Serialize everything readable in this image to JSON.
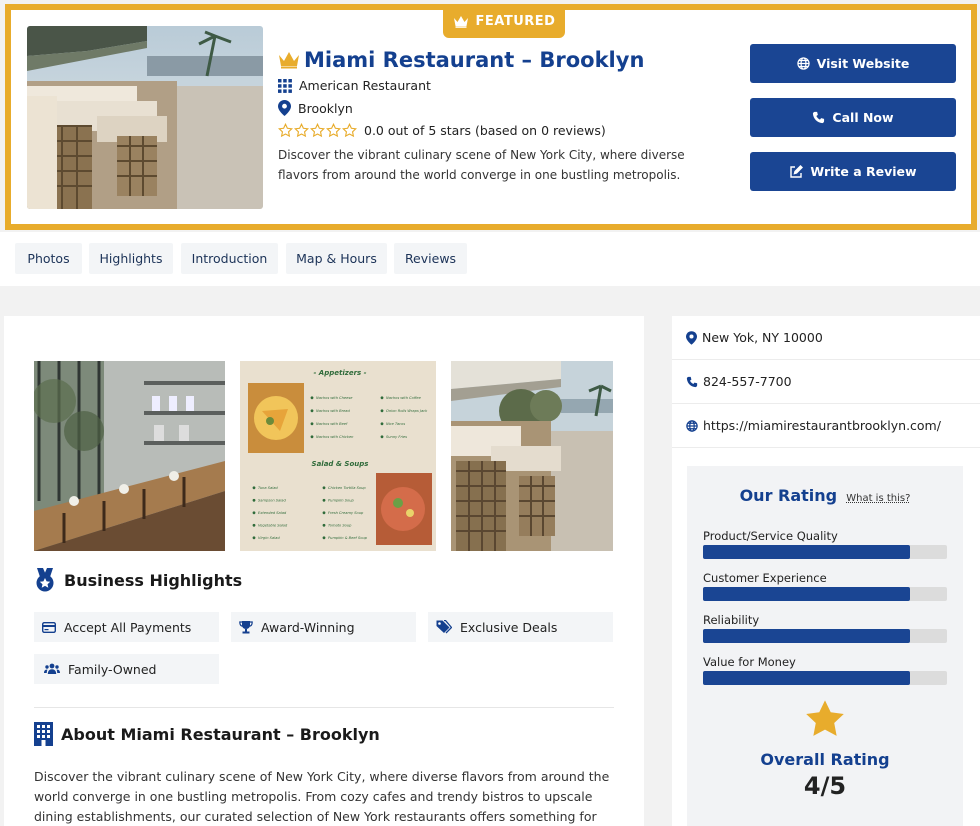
{
  "featured_badge": "FEATURED",
  "listing": {
    "title": "Miami Restaurant – Brooklyn",
    "category": "American Restaurant",
    "location": "Brooklyn",
    "stars_total": 5,
    "rating_text": "0.0 out of 5 stars (based on 0 reviews)",
    "description": "Discover the vibrant culinary scene of New York City, where diverse flavors from around the world converge in one bustling metropolis."
  },
  "actions": {
    "visit_website": "Visit Website",
    "call_now": "Call Now",
    "write_review": "Write a Review"
  },
  "tabs": [
    "Photos",
    "Highlights",
    "Introduction",
    "Map & Hours",
    "Reviews"
  ],
  "menu": {
    "appetizers_title": "- Appetizers -",
    "salad_title": "Salad & Soups",
    "appetizers_left": [
      "Nachos with Cheese",
      "Nachos with Bread",
      "Nachos with Beef",
      "Nachos with Chicken"
    ],
    "appetizers_right": [
      "Nachos with Coffee",
      "Onion Rolls Wraps Jack",
      "Nice Tacos",
      "Sunny Fries"
    ],
    "salad_left": [
      "Tuna Salad",
      "Sampson Salad",
      "Extended Salad",
      "Vegetable Salad",
      "Virgin Salad"
    ],
    "salad_right": [
      "Chicken Tortilla Soup",
      "Pumpkin Soup",
      "Fresh Creamy Soup",
      "Tomato Soup",
      "Pumpkin & Beef Soup"
    ]
  },
  "highlights": {
    "heading": "Business Highlights",
    "items": [
      "Accept All Payments",
      "Award-Winning",
      "Exclusive Deals",
      "Family-Owned"
    ]
  },
  "about": {
    "heading": "About Miami Restaurant – Brooklyn",
    "text": "Discover the vibrant culinary scene of New York City, where diverse flavors from around the world converge in one bustling metropolis. From cozy cafes and trendy bistros to upscale dining establishments, our curated selection of New York restaurants offers something for every palate."
  },
  "contact": {
    "address": "New Yok, NY 10000",
    "phone": "824-557-7700",
    "website": "https://miamirestaurantbrooklyn.com/"
  },
  "rating_panel": {
    "title": "Our Rating",
    "what_is_this": "What is this?",
    "metrics": [
      {
        "label": "Product/Service Quality",
        "value": 0.85
      },
      {
        "label": "Customer Experience",
        "value": 0.85
      },
      {
        "label": "Reliability",
        "value": 0.85
      },
      {
        "label": "Value for Money",
        "value": 0.85
      }
    ],
    "overall_label": "Overall Rating",
    "overall_value": "4/5"
  },
  "colors": {
    "accent_gold": "#e8ac2c",
    "brand_blue": "#1a4593",
    "title_blue": "#14408f"
  }
}
